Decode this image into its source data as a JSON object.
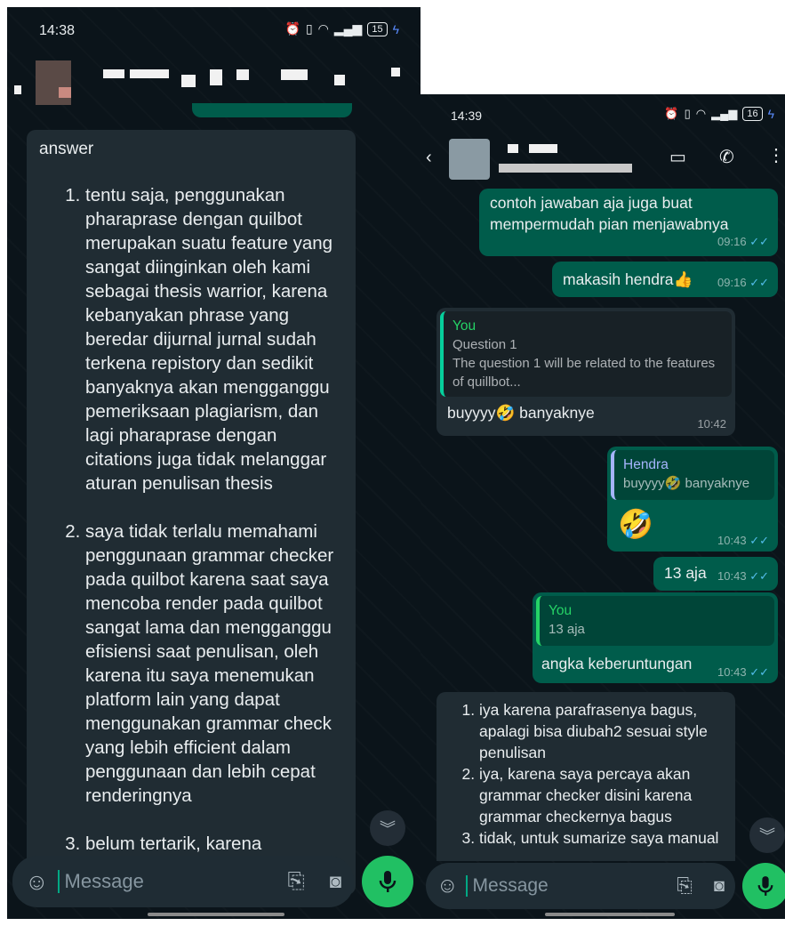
{
  "left": {
    "status_time": "14:38",
    "battery": "15",
    "answer_title": "answer",
    "items": [
      "tentu saja, penggunakan pharaprase dengan quilbot merupakan suatu feature yang sangat diinginkan oleh kami sebagai thesis warrior, karena kebanyakan phrase yang beredar dijurnal jurnal sudah terkena repistory dan sedikit banyaknya akan mengganggu pemeriksaan plagiarism, dan lagi pharaprase dengan citations juga tidak melanggar aturan penulisan thesis",
      "saya tidak terlalu memahami penggunaan grammar checker pada quilbot karena saat saya mencoba render pada quilbot sangat lama dan mengganggu efisiensi saat penulisan, oleh karena itu saya menemukan platform lain yang dapat menggunakan grammar check yang lebih efficient dalam penggunaan dan lebih cepat renderingnya",
      "belum tertarik, karena"
    ],
    "message_placeholder": "Message"
  },
  "right": {
    "status_time": "14:39",
    "battery": "16",
    "msg1": {
      "text": "contoh jawaban aja juga buat mempermudah pian menjawabnya",
      "time": "09:16"
    },
    "msg2": {
      "text": "makasih hendra",
      "emoji": "👍",
      "time": "09:16"
    },
    "msg3": {
      "quote_name": "You",
      "quote_line1": "Question 1",
      "quote_line2": "The question 1 will be related to the features of quillbot...",
      "text_a": "buyyyy",
      "emoji": "🤣",
      "text_b": " banyaknye",
      "time": "10:42"
    },
    "msg4": {
      "quote_name": "Hendra",
      "quote_text_a": "buyyyy",
      "quote_emoji": "🤣",
      "quote_text_b": " banyaknye",
      "emoji": "🤣",
      "time": "10:43"
    },
    "msg5": {
      "text": "13 aja",
      "time": "10:43"
    },
    "msg6": {
      "quote_name": "You",
      "quote_text": "13 aja",
      "text": "angka keberuntungan",
      "time": "10:43"
    },
    "msg7": {
      "items": [
        "iya karena parafrasenya bagus, apalagi bisa diubah2 sesuai style penulisan",
        "iya, karena saya percaya akan grammar checker disini karena grammar checkernya bagus",
        "tidak, untuk sumarize saya manual"
      ]
    },
    "message_placeholder": "Message"
  },
  "colors": {
    "chat_bg": "#0b141a",
    "incoming_bubble": "#202c33",
    "outgoing_bubble": "#005c4b",
    "accent_green": "#21c063",
    "read_ticks": "#53bdeb"
  }
}
